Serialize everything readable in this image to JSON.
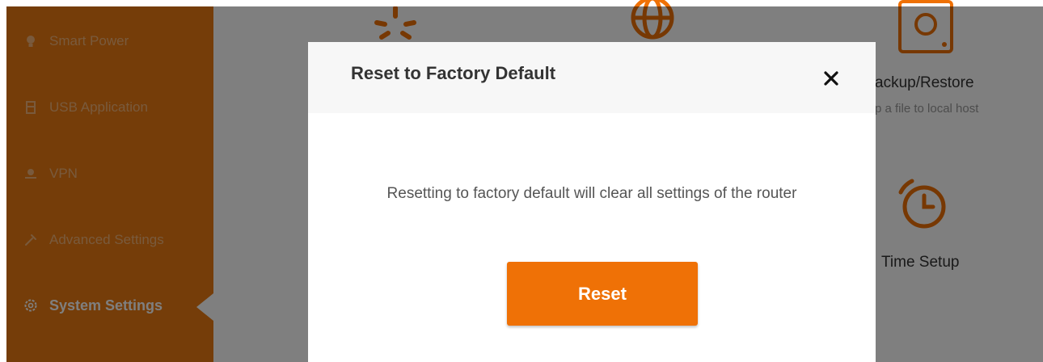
{
  "sidebar": {
    "items": [
      {
        "label": "Smart Power",
        "icon": "bulb-icon"
      },
      {
        "label": "USB Application",
        "icon": "usb-icon"
      },
      {
        "label": "VPN",
        "icon": "vpn-icon"
      },
      {
        "label": "Advanced Settings",
        "icon": "wrench-icon"
      },
      {
        "label": "System Settings",
        "icon": "gear-icon",
        "active": true
      }
    ]
  },
  "main": {
    "tiles": [
      {
        "title": "ackup/Restore",
        "description": "p a file to local host",
        "icon": "hard-drive-icon"
      },
      {
        "title": "Time Setup",
        "icon": "clock-icon"
      }
    ],
    "partial_icons": [
      "reboot-icon",
      "globe-icon"
    ]
  },
  "dialog": {
    "title": "Reset to Factory Default",
    "close_icon": "close-icon",
    "message": "Resetting to factory default will clear all settings of the router",
    "button_label": "Reset"
  },
  "colors": {
    "accent": "#ef7106",
    "sidebar_bg": "#ea7a12",
    "overlay": "rgba(0,0,0,0.5)"
  }
}
